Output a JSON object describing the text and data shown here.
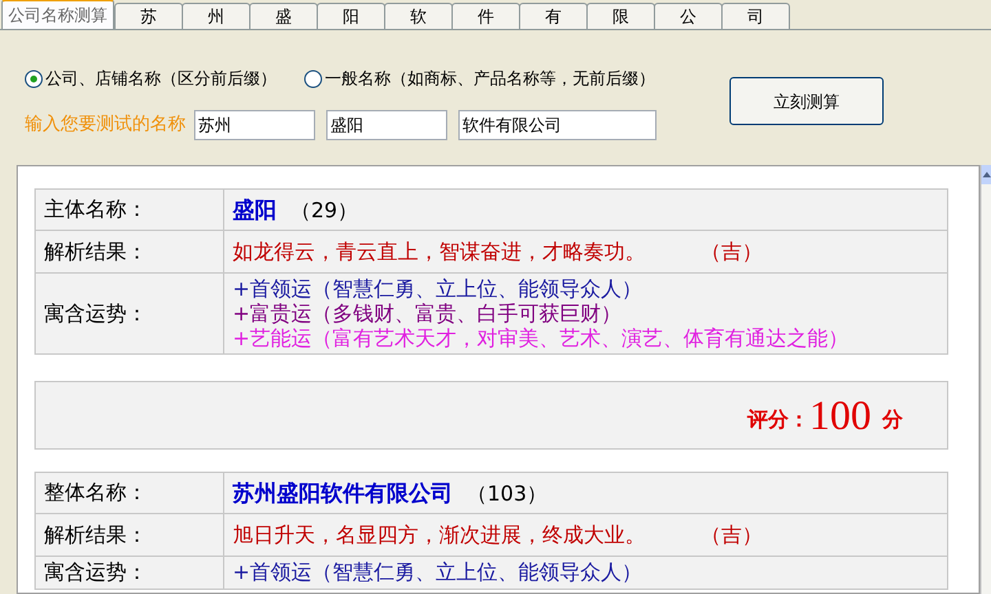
{
  "tabs": [
    {
      "label": "公司名称测算",
      "selected": true
    },
    {
      "label": "苏",
      "selected": false
    },
    {
      "label": "州",
      "selected": false
    },
    {
      "label": "盛",
      "selected": false
    },
    {
      "label": "阳",
      "selected": false
    },
    {
      "label": "软",
      "selected": false
    },
    {
      "label": "件",
      "selected": false
    },
    {
      "label": "有",
      "selected": false
    },
    {
      "label": "限",
      "selected": false
    },
    {
      "label": "公",
      "selected": false
    },
    {
      "label": "司",
      "selected": false
    }
  ],
  "options": [
    {
      "label": "公司、店铺名称（区分前后缀）",
      "selected": true
    },
    {
      "label": "一般名称（如商标、产品名称等，无前后缀）",
      "selected": false
    }
  ],
  "calculate_button": "立刻测算",
  "input_label": "输入您要测试的名称",
  "inputs": [
    "苏州",
    "盛阳",
    "软件有限公司"
  ],
  "sections": [
    {
      "rows": [
        {
          "kind": "name",
          "label": "主体名称：",
          "name": "盛阳",
          "count": "（29）"
        },
        {
          "kind": "result",
          "label": "解析结果：",
          "text": "如龙得云，青云直上，智谋奋进，才略奏功。",
          "verdict": "（吉）"
        },
        {
          "kind": "fortunes",
          "label": "寓含运势：",
          "lines": [
            {
              "text": "+首领运（智慧仁勇、立上位、能领导众人）",
              "color": "#1a1aa0"
            },
            {
              "text": "+富贵运（多钱财、富贵、白手可获巨财）",
              "color": "#800080"
            },
            {
              "text": "+艺能运（富有艺术天才，对审美、艺术、演艺、体育有通达之能）",
              "color": "#e020e0"
            }
          ]
        }
      ],
      "score": {
        "label": "评分：",
        "value": "100",
        "unit": "分"
      }
    },
    {
      "rows": [
        {
          "kind": "name",
          "label": "整体名称：",
          "name": "苏州盛阳软件有限公司",
          "count": "（103）"
        },
        {
          "kind": "result",
          "label": "解析结果：",
          "text": "旭日升天，名显四方，渐次进展，终成大业。",
          "verdict": "（吉）"
        },
        {
          "kind": "fortunes",
          "label": "寓含运势：",
          "lines": [
            {
              "text": "+首领运（智慧仁勇、立上位、能领导众人）",
              "color": "#1a1aa0"
            }
          ]
        }
      ]
    }
  ]
}
